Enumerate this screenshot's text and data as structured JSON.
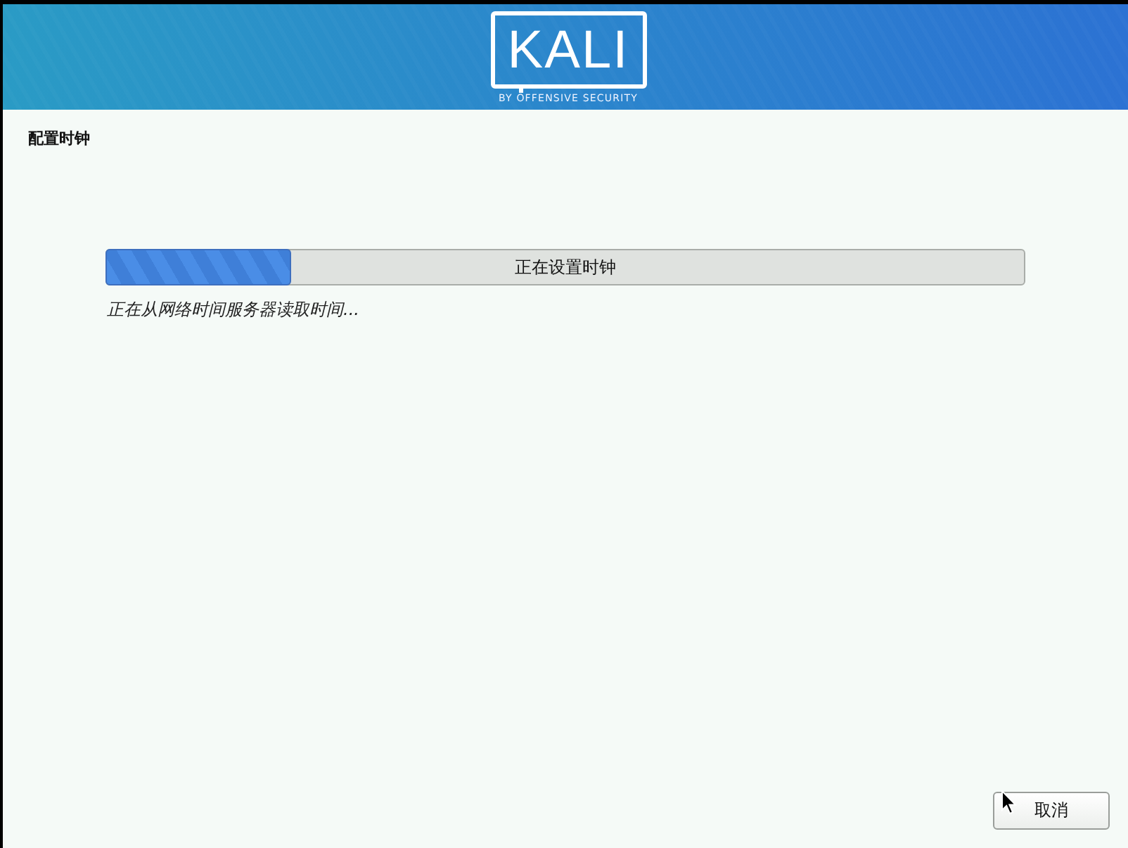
{
  "header": {
    "logo": {
      "wordmark": "KALI",
      "tagline": "BY OFFENSIVE SECURITY"
    }
  },
  "page": {
    "title": "配置时钟"
  },
  "progress": {
    "label": "正在设置时钟",
    "level": 0.2,
    "status": "正在从网络时间服务器读取时间..."
  },
  "buttons": [
    {
      "label": "取消",
      "kind": "cancel"
    }
  ]
}
